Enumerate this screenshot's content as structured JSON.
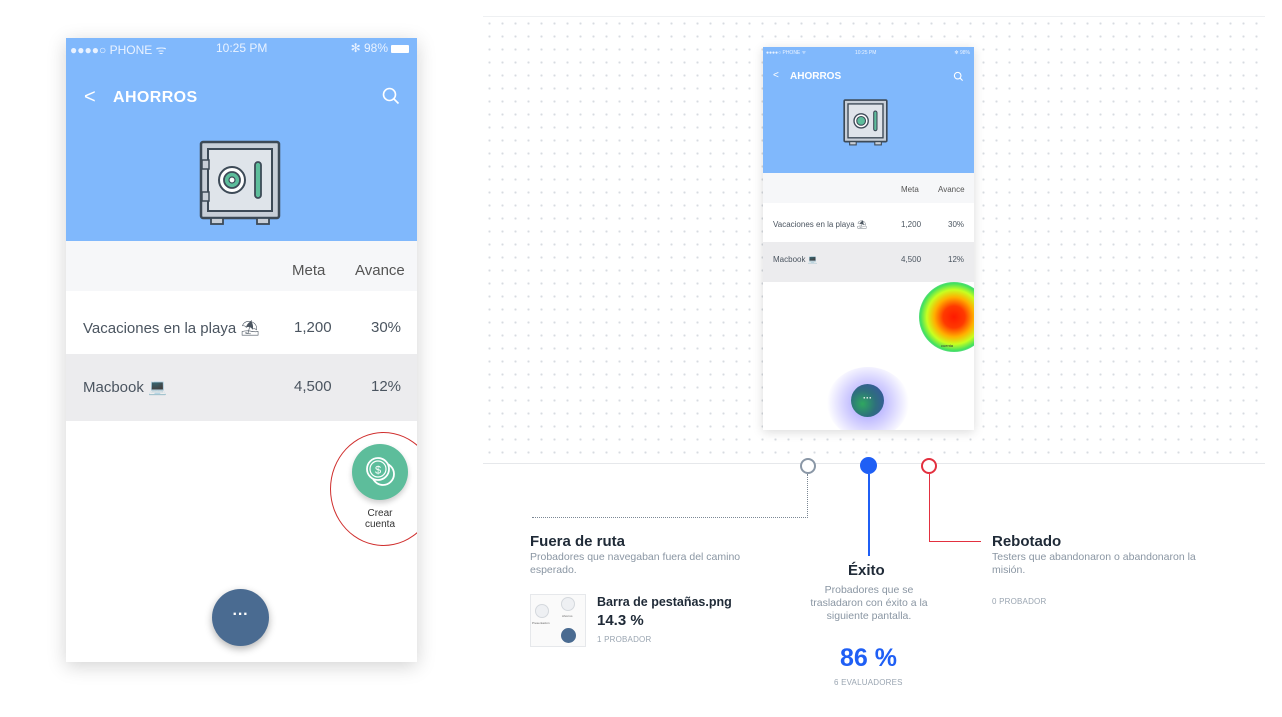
{
  "phone": {
    "status": {
      "carrier": "●●●●○ PHONE ᯤ",
      "time": "10:25 PM",
      "battery": "✻ 98%"
    },
    "header": {
      "back_label": "<",
      "title": "AHORROS"
    },
    "table": {
      "headers": {
        "goal": "Meta",
        "progress": "Avance"
      },
      "rows": [
        {
          "name": "Vacaciones en la playa ⛱",
          "goal": "1,200",
          "progress": "30%"
        },
        {
          "name": "Macbook 💻",
          "goal": "4,500",
          "progress": "12%"
        }
      ]
    },
    "fab_create_label_1": "Crear",
    "fab_create_label_2": "cuenta",
    "fab_more_label": "···"
  },
  "mini_preview": {
    "status": {
      "carrier": "●●●●○ PHONE ᯤ",
      "time": "10:25 PM",
      "battery": "✻ 98%"
    },
    "back_label": "<",
    "title": "AHORROS",
    "headers": {
      "goal": "Meta",
      "progress": "Avance"
    },
    "rows": [
      {
        "name": "Vacaciones en la playa ⛱",
        "goal": "1,200",
        "progress": "30%"
      },
      {
        "name": "Macbook 💻",
        "goal": "4,500",
        "progress": "12%"
      }
    ],
    "heat_label": "cuenta",
    "fab_label": "···"
  },
  "results": {
    "off_route": {
      "title": "Fuera de ruta",
      "description": "Probadores que navegaban fuera del camino esperado.",
      "file_name": "Barra de pestañas.png",
      "percent": "14.3 %",
      "count": "1 PROBADOR",
      "thumb_label_1": "Presentación",
      "thumb_label_2": "Ahorros"
    },
    "success": {
      "title": "Éxito",
      "description": "Probadores que se trasladaron con éxito a la siguiente pantalla.",
      "percent": "86 %",
      "count": "6 EVALUADORES"
    },
    "bounced": {
      "title": "Rebotado",
      "description": "Testers que abandonaron o abandonaron la misión.",
      "count": "0 PROBADOR"
    }
  },
  "colors": {
    "header_blue": "#80b8fc",
    "fab_green": "#5dbd9b",
    "fab_dark": "#4a6b91",
    "success_blue": "#1f5ff5",
    "bounce_red": "#e3303f",
    "offroute_gray": "#8a97a6"
  }
}
